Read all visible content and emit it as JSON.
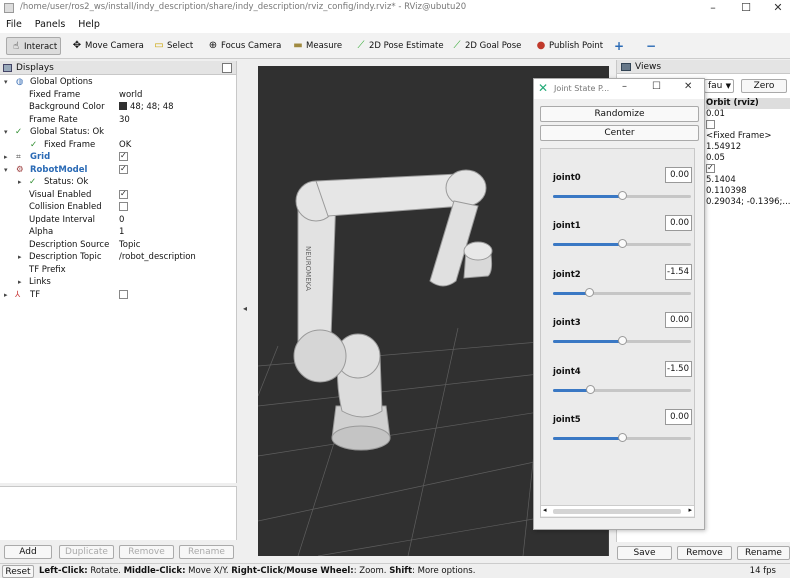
{
  "window": {
    "title": "/home/user/ros2_ws/install/indy_description/share/indy_description/rviz_config/indy.rviz* - RViz@ubutu20"
  },
  "menu": [
    "File",
    "Panels",
    "Help"
  ],
  "toolbar": {
    "interact": "Interact",
    "move_camera": "Move Camera",
    "select": "Select",
    "focus_camera": "Focus Camera",
    "measure": "Measure",
    "pose_estimate": "2D Pose Estimate",
    "goal_pose": "2D Goal Pose",
    "publish_point": "Publish Point"
  },
  "displays": {
    "title": "Displays",
    "rows": [
      {
        "label": "Global Options",
        "value": ""
      },
      {
        "label": "Fixed Frame",
        "value": "world"
      },
      {
        "label": "Background Color",
        "value": "48; 48; 48"
      },
      {
        "label": "Frame Rate",
        "value": "30"
      },
      {
        "label": "Global Status: Ok",
        "value": ""
      },
      {
        "label": "Fixed Frame",
        "value": "OK"
      },
      {
        "label": "Grid",
        "value": ""
      },
      {
        "label": "RobotModel",
        "value": ""
      },
      {
        "label": "Status: Ok",
        "value": ""
      },
      {
        "label": "Visual Enabled",
        "value": ""
      },
      {
        "label": "Collision Enabled",
        "value": ""
      },
      {
        "label": "Update Interval",
        "value": "0"
      },
      {
        "label": "Alpha",
        "value": "1"
      },
      {
        "label": "Description Source",
        "value": "Topic"
      },
      {
        "label": "Description Topic",
        "value": "/robot_description"
      },
      {
        "label": "TF Prefix",
        "value": ""
      },
      {
        "label": "Links",
        "value": ""
      },
      {
        "label": "TF",
        "value": ""
      }
    ],
    "buttons": {
      "add": "Add",
      "duplicate": "Duplicate",
      "remove": "Remove",
      "rename": "Rename"
    }
  },
  "views": {
    "title": "Views",
    "type_value": "fau",
    "zero": "Zero",
    "current": "Orbit (rviz)",
    "values": [
      "0.01",
      "<Fixed Frame>",
      "1.54912",
      "0.05",
      "5.1404",
      "0.110398",
      "0.29034; -0.1396;..."
    ],
    "buttons": {
      "save": "Save",
      "remove": "Remove",
      "rename": "Rename"
    }
  },
  "jsp": {
    "title": "Joint State P...",
    "randomize": "Randomize",
    "center": "Center",
    "joints": [
      {
        "name": "joint0",
        "value": "0.00",
        "fraction": 0.5
      },
      {
        "name": "joint1",
        "value": "0.00",
        "fraction": 0.5
      },
      {
        "name": "joint2",
        "value": "-1.54",
        "fraction": 0.26
      },
      {
        "name": "joint3",
        "value": "0.00",
        "fraction": 0.5
      },
      {
        "name": "joint4",
        "value": "-1.50",
        "fraction": 0.27
      },
      {
        "name": "joint5",
        "value": "0.00",
        "fraction": 0.5
      }
    ]
  },
  "status": {
    "reset": "Reset",
    "hint_1": "Left-Click:",
    "hint_2": " Rotate. ",
    "hint_3": "Middle-Click:",
    "hint_4": " Move X/Y. ",
    "hint_5": "Right-Click/Mouse Wheel:",
    "hint_6": ": Zoom. ",
    "hint_7": "Shift",
    "hint_8": ": More options.",
    "fps": "14 fps"
  },
  "colors": {
    "viewport_bg": "#303030",
    "slider_fill": "#3a78c4",
    "ok_green": "#2a8a2a",
    "display_blue": "#2a6ab5"
  }
}
